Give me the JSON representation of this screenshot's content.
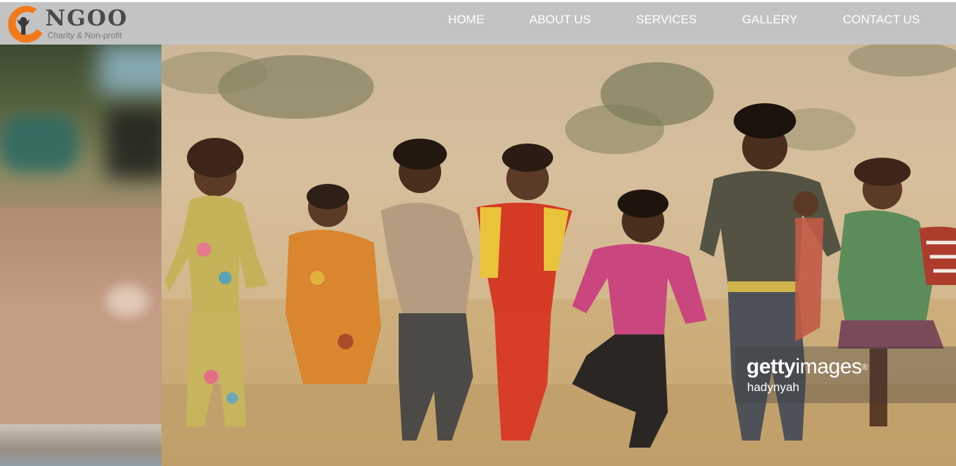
{
  "brand": {
    "name": "NGOO",
    "tagline": "Charity & Non-profit",
    "accent_color": "#f27a1a"
  },
  "nav": {
    "items": [
      {
        "label": "HOME"
      },
      {
        "label": "ABOUT US"
      },
      {
        "label": "SERVICES"
      },
      {
        "label": "GALLERY"
      },
      {
        "label": "CONTACT US"
      }
    ]
  },
  "hero": {
    "watermark_brand_bold": "getty",
    "watermark_brand_light": "images",
    "watermark_reg": "®",
    "watermark_user": "hadynyah"
  }
}
